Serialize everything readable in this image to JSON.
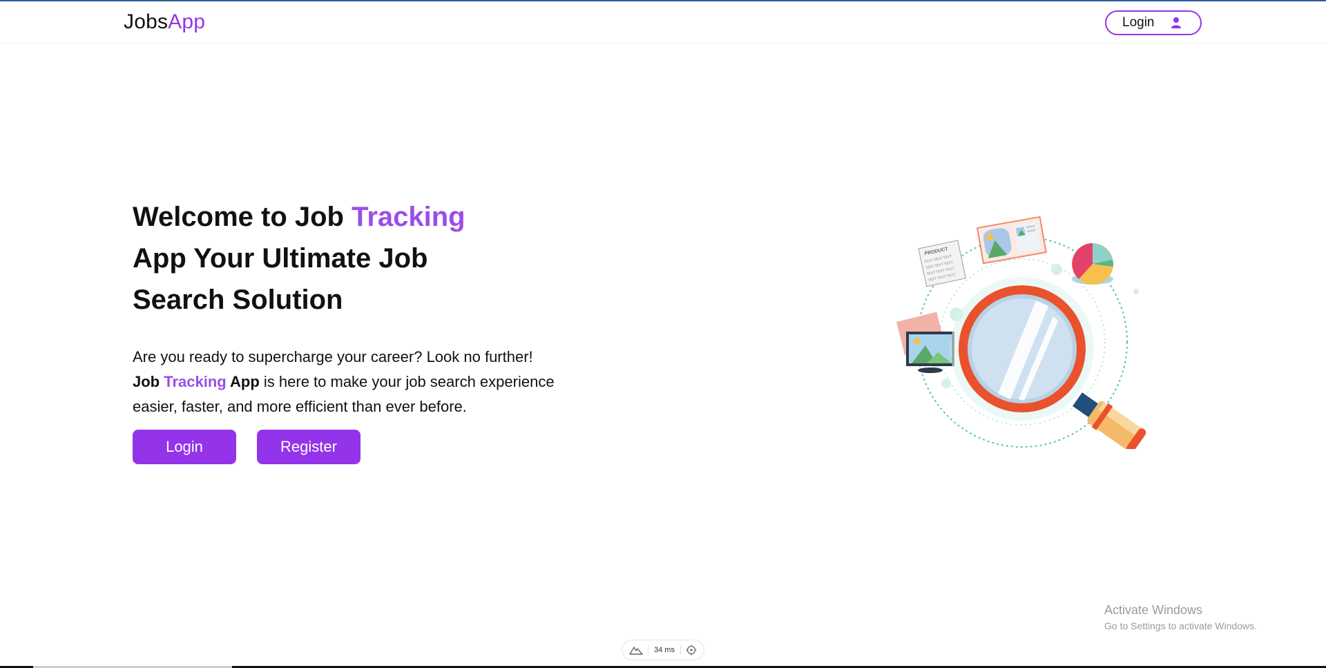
{
  "header": {
    "logo_part1": "Jobs",
    "logo_part2": "App",
    "login_label": "Login"
  },
  "hero": {
    "title_part1": "Welcome to Job ",
    "title_accent": "Tracking",
    "title_part2": "App Your Ultimate Job",
    "title_part3": "Search Solution",
    "text_line1": "Are you ready to supercharge your career? Look no further!",
    "text_bold1": "Job ",
    "text_accent": "Tracking",
    "text_bold2": " App",
    "text_line2_rest": " is here to make your job search experience",
    "text_line3": "easier, faster, and more efficient than ever before.",
    "login_button": "Login",
    "register_button": "Register"
  },
  "illustration": {
    "product_card_lines": [
      "PRODUCT",
      "TEXT TEXT TEXT",
      "TEXT TEXT TEXT",
      "TEXT TEXT TEXT",
      "TEXT TEXT TEXT"
    ]
  },
  "watermark": {
    "line1": "Activate Windows",
    "line2": "Go to Settings to activate Windows."
  },
  "devtools": {
    "timing": "34 ms"
  },
  "colors": {
    "accent": "#9333ea",
    "accent_text": "#9b4de8",
    "magnifier_ring": "#e9522c",
    "handle": "#f5b96a"
  }
}
